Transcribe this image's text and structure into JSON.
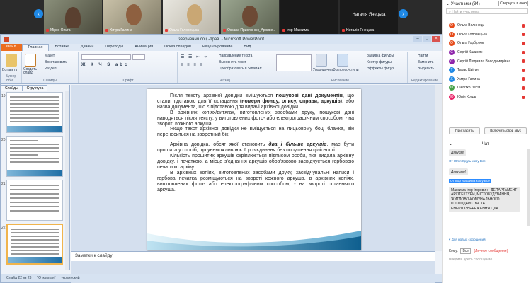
{
  "video_strip": {
    "participants": [
      {
        "name": "Мірох Ольга"
      },
      {
        "name": "Хитра Галина"
      },
      {
        "name": "Ольга Головецька"
      },
      {
        "name": "Оксана Присяжнюк_Архиве..."
      },
      {
        "name": "Ігор Максима"
      },
      {
        "name": "Наталія Янецька"
      }
    ]
  },
  "window": {
    "title": "звернення соц.-прав. - Microsoft PowerPoint"
  },
  "ribbon_tabs": [
    "Файл",
    "Главная",
    "Вставка",
    "Дизайн",
    "Переходы",
    "Анимация",
    "Показ слайдов",
    "Рецензирование",
    "Вид"
  ],
  "ribbon": {
    "groups": [
      "Буфер обм...",
      "Слайды",
      "Шрифт",
      "Абзац",
      "Рисование",
      "Редактирование"
    ],
    "items": {
      "paste": "Вставить",
      "create_slide": "Создать слайд",
      "layout": "Макет",
      "reset": "Восстановить",
      "section": "Раздел",
      "text_dir": "Направление текста",
      "align_text": "Выровнять текст",
      "smartart": "Преобразовать в SmartArt",
      "arrange": "Упорядочить",
      "quick_styles": "Экспресс-стили",
      "fill": "Заливка фигуры",
      "outline": "Контур фигуры",
      "effects": "Эффекты фигур",
      "find": "Найти",
      "replace": "Заменить",
      "select": "Выделить"
    }
  },
  "left_pane": {
    "tabs": [
      "Слайды",
      "Структура"
    ],
    "slide_numbers": [
      "19",
      "20",
      "21",
      "22"
    ]
  },
  "slide": {
    "paragraphs": [
      [
        {
          "t": "Після тексту архівної довідки вміщуються "
        },
        {
          "t": "пошукові дані документів",
          "b": true
        },
        {
          "t": ", що стали підставою для її складання ("
        },
        {
          "t": "номери фонду, опису, справи, аркушів",
          "b": true
        },
        {
          "t": "), або назва документа, що є підставою для видачі архівної довідки."
        }
      ],
      [
        {
          "t": "В архівних копіях/витягах, виготовлених засобами друку, пошукові дані наводяться після тексту, у виготовлених фото- або електрографічним способом, - на звороті кожного аркуша."
        }
      ],
      [
        {
          "t": "Якщо текст архівної довідки не вміщується на лицьовому боці бланка, він переноситься на зворотний бік."
        }
      ],
      [
        {
          "t": "gap"
        }
      ],
      [
        {
          "t": "Архівна довідка, обсяг якої становить "
        },
        {
          "t": "два і більше аркушів",
          "b": true,
          "i": true
        },
        {
          "t": ", має бути прошита у спосіб, що унеможливлює її роз’єднання без порушення цілісності."
        }
      ],
      [
        {
          "t": "Кількість прошитих аркушів скріплюється підписом особи, яка видала архівну довідку, і печаткою, а місце з’єднання аркушів обов’язково засвідчується гербовою печаткою архіву."
        }
      ],
      [
        {
          "t": "В архівних копіях, виготовлених засобами друку, засвідчувальні написи і гербова печатка розміщуються на звороті кожного аркуша, в архівних копіях, виготовлених фото- або електрографічним способом, - на звороті останнього аркуша."
        }
      ]
    ]
  },
  "notes": {
    "placeholder": "Заметки к слайду"
  },
  "status_bar": {
    "slide": "Слайд 22 из 23",
    "theme": "\"Открытая\"",
    "lang": "украинский"
  },
  "side_panel": {
    "header": "Участники (34)",
    "header_link": "Свернуть в окно",
    "search_placeholder": "Найти участника",
    "participants": [
      {
        "name": "Ольга Волинець",
        "initial": "О",
        "color": "#e64a19"
      },
      {
        "name": "Ольга Головецька",
        "initial": "О",
        "color": "#e64a19"
      },
      {
        "name": "Ольга Горбулюк",
        "initial": "О",
        "color": "#e64a19"
      },
      {
        "name": "Сергій Калиняк",
        "initial": "С",
        "color": "#8e24aa"
      },
      {
        "name": "Сергій Людмила Володимирівна",
        "initial": "С",
        "color": "#8e24aa"
      },
      {
        "name": "Тарас Цвігун",
        "initial": "Т",
        "color": "#1e88e5"
      },
      {
        "name": "Хитра Галина",
        "initial": "Х",
        "color": "#1e88e5"
      },
      {
        "name": "Шепітко Лесія",
        "initial": "Ш",
        "color": "#43a047"
      },
      {
        "name": "Юлія Крудь",
        "initial": "Ю",
        "color": "#e91e63"
      }
    ],
    "buttons": [
      "Пригласить",
      "Включить свой звук"
    ],
    "chat_title": "Чат",
    "chat": [
      {
        "kind": "msg",
        "text": "Дякуєм!"
      },
      {
        "kind": "meta",
        "text": "От Юлія Крудь кому Все"
      },
      {
        "kind": "msg",
        "text": "Дякуємо!"
      },
      {
        "kind": "meta",
        "text": "От Ігор Максима кому Все"
      },
      {
        "kind": "msg",
        "text": "Максима Ігор Ігорович - ДЕПАРТАМЕНТ АРХІТЕКТУРИ, МІСТОБУДУВАННЯ, ЖИТЛОВО-КОМУНАЛЬНОГО ГОСПОДАРСТВА ТА ЕНЕРГОЗБЕРЕЖЕННЯ ОДА"
      }
    ],
    "new_msg": "Для новых сообщений",
    "to_label": "Кому:",
    "to_value": "Все",
    "private_label": "(Личное сообщение)",
    "input_placeholder": "Введите здесь сообщение..."
  }
}
